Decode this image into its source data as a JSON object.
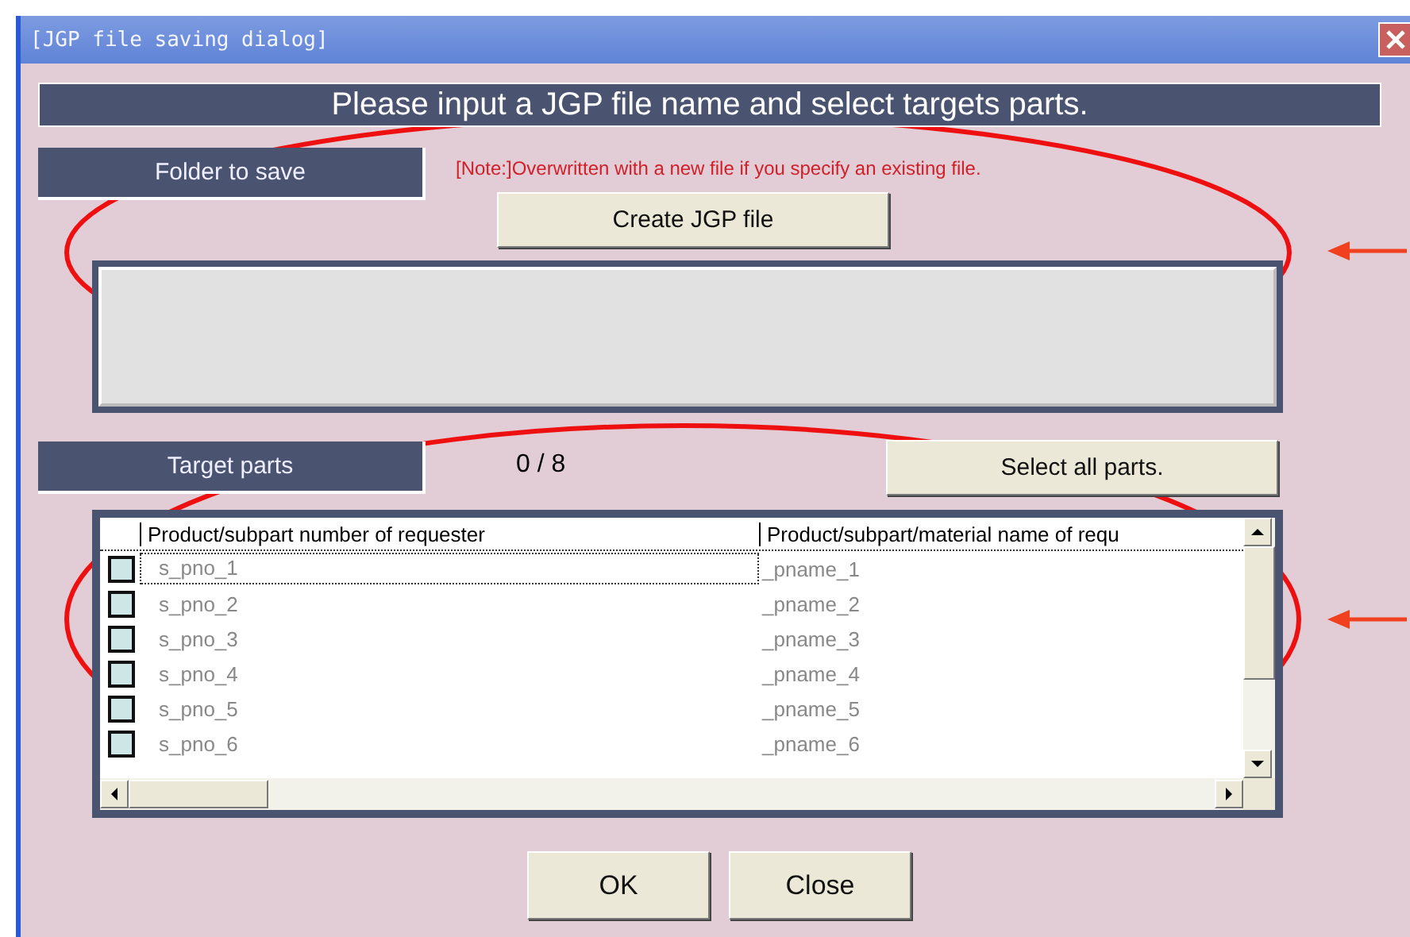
{
  "window": {
    "title": "[JGP file saving dialog]"
  },
  "header": "Please input a JGP file name and select targets parts.",
  "folder": {
    "label": "Folder to save",
    "note": "[Note:]Overwritten with a new file if you specify an existing file.",
    "create_button": "Create JGP file"
  },
  "targets": {
    "label": "Target parts",
    "count": "0 / 8",
    "select_all_button": "Select all parts."
  },
  "parts_list": {
    "columns": [
      "Product/subpart number of requester",
      "Product/subpart/material name of requ"
    ],
    "rows": [
      {
        "checked": false,
        "focused": true,
        "cells": [
          "s_pno_1",
          "_pname_1"
        ]
      },
      {
        "checked": false,
        "focused": false,
        "cells": [
          "s_pno_2",
          "_pname_2"
        ]
      },
      {
        "checked": false,
        "focused": false,
        "cells": [
          "s_pno_3",
          "_pname_3"
        ]
      },
      {
        "checked": false,
        "focused": false,
        "cells": [
          "s_pno_4",
          "_pname_4"
        ]
      },
      {
        "checked": false,
        "focused": false,
        "cells": [
          "s_pno_5",
          "_pname_5"
        ]
      },
      {
        "checked": false,
        "focused": false,
        "cells": [
          "s_pno_6",
          "_pname_6"
        ]
      }
    ]
  },
  "buttons": [
    "OK",
    "Close"
  ]
}
